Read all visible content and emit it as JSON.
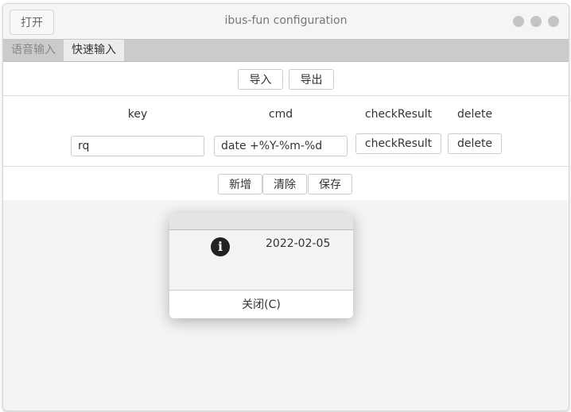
{
  "window": {
    "title": "ibus-fun configuration",
    "open_label": "打开"
  },
  "tabs": [
    {
      "label": "语音输入",
      "active": false
    },
    {
      "label": "快速输入",
      "active": true
    }
  ],
  "toolbar": {
    "import_label": "导入",
    "export_label": "导出"
  },
  "table": {
    "headers": [
      "key",
      "cmd",
      "checkResult",
      "delete"
    ],
    "rows": [
      {
        "key": "rq",
        "cmd": "date +%Y-%m-%d",
        "check_label": "checkResult",
        "delete_label": "delete"
      }
    ]
  },
  "actions": {
    "add_label": "新增",
    "clear_label": "清除",
    "save_label": "保存"
  },
  "dialog": {
    "icon": "info-icon",
    "message": "2022-02-05",
    "close_label": "关闭(C)"
  }
}
